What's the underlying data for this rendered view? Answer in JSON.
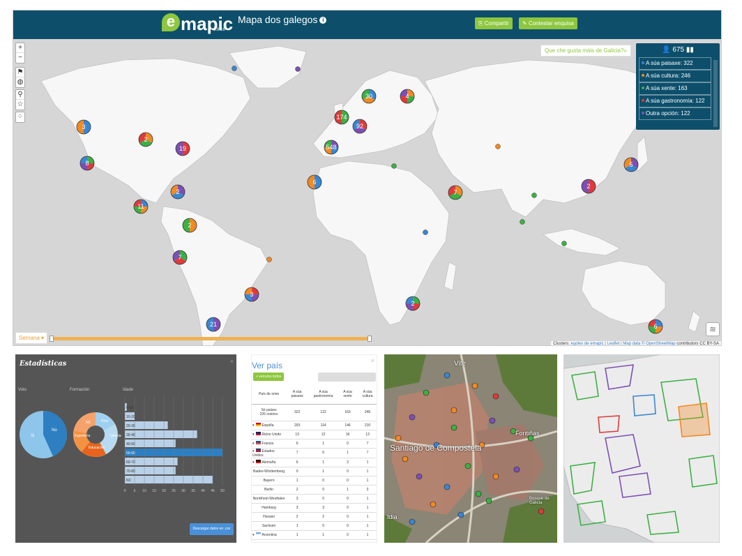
{
  "app": {
    "logo_text": "mapic",
    "logo_e": "e",
    "logo_sub": "3.8.16",
    "title": "Mapa dos galegos",
    "info_icon": "i",
    "share_label": "Compartir",
    "survey_label": "Contestar enquisa"
  },
  "map": {
    "question_link": "Que che gusta máis de Galicia?»",
    "zoom_in": "+",
    "zoom_out": "−",
    "semana_label": "Semana",
    "attribution_prefix": "Clusters:",
    "attribution_links": "egoles de emapic | Leaflet | Map data © OpenStreetMap",
    "attribution_suffix": "contributors CC BY-SA",
    "legend": {
      "count": "675",
      "items": [
        {
          "label": "A súa paisaxe: 322",
          "color": "#3a86d1"
        },
        {
          "label": "A súa cultura: 246",
          "color": "#f08a24"
        },
        {
          "label": "A súa xente: 163",
          "color": "#3cb043"
        },
        {
          "label": "A súa gastronomía: 122",
          "color": "#e03b3b"
        },
        {
          "label": "Outra opción: 122",
          "color": "#7d4fb5"
        }
      ]
    },
    "clusters": [
      {
        "label": "3"
      },
      {
        "label": "2"
      },
      {
        "label": "8"
      },
      {
        "label": "19"
      },
      {
        "label": "2"
      },
      {
        "label": "11"
      },
      {
        "label": "2"
      },
      {
        "label": "7"
      },
      {
        "label": "3"
      },
      {
        "label": "21"
      },
      {
        "label": "30"
      },
      {
        "label": "4"
      },
      {
        "label": "174"
      },
      {
        "label": "92"
      },
      {
        "label": "548"
      },
      {
        "label": "6"
      },
      {
        "label": "7"
      },
      {
        "label": "2"
      },
      {
        "label": "2"
      },
      {
        "label": "5"
      },
      {
        "label": "6"
      }
    ]
  },
  "stats": {
    "title": "Estadísticas",
    "close": "×",
    "vote_label": "Voto",
    "education_label": "Formación",
    "age_label": "Idade",
    "pie_no": "No",
    "pie_si": "Si",
    "donut_labels": [
      "Pote",
      "NC",
      "Ciencia",
      "Educación",
      "Ingeniería"
    ],
    "age_rows": [
      {
        "label": "0-10",
        "value": 1
      },
      {
        "label": "10-20",
        "value": 5
      },
      {
        "label": "20-30",
        "value": 22
      },
      {
        "label": "30-40",
        "value": 37
      },
      {
        "label": "40-50",
        "value": 26
      },
      {
        "label": "50-60",
        "value": 50
      },
      {
        "label": "60-70",
        "value": 27
      },
      {
        "label": "70-80",
        "value": 26
      },
      {
        "label": "NC",
        "value": 45
      }
    ],
    "age_ticks": [
      "0",
      "5",
      "10",
      "15",
      "20",
      "25",
      "30",
      "35",
      "40",
      "45",
      "50"
    ],
    "download_label": "Descargar datos en .csv"
  },
  "verpais": {
    "title": "Ver país",
    "close": "×",
    "tabs_label": "+ veículos    todos",
    "headers": [
      "País de orixe",
      "A súa paisaxe",
      "A súa gastronomía",
      "A súa xente",
      "A súa cultura"
    ],
    "total_label": "Só países",
    "total_sub": "226 rexións",
    "total_values": [
      "322",
      "122",
      "163",
      "246"
    ],
    "rows": [
      {
        "name": "España",
        "values": [
          "293",
          "114",
          "146",
          "210"
        ],
        "flag": "es"
      },
      {
        "name": "Reino Unido",
        "values": [
          "13",
          "12",
          "16",
          "13"
        ],
        "flag": "uk"
      },
      {
        "name": "Francia",
        "values": [
          "6",
          "1",
          "0",
          "7"
        ],
        "flag": "fr"
      },
      {
        "name": "Estados Unidos",
        "values": [
          "7",
          "6",
          "1",
          "7"
        ],
        "flag": "us"
      },
      {
        "name": "Alemaña",
        "values": [
          "6",
          "1",
          "3",
          "1"
        ],
        "flag": "de"
      },
      {
        "name": "Baden-Württemberg",
        "values": [
          "0",
          "1",
          "0",
          "1"
        ],
        "flag": ""
      },
      {
        "name": "Bayern",
        "values": [
          "1",
          "0",
          "0",
          "1"
        ],
        "flag": ""
      },
      {
        "name": "Berlin",
        "values": [
          "2",
          "0",
          "1",
          "3"
        ],
        "flag": ""
      },
      {
        "name": "Nordrhein-Westfalen",
        "values": [
          "3",
          "0",
          "0",
          "1"
        ],
        "flag": ""
      },
      {
        "name": "Hamburg",
        "values": [
          "3",
          "3",
          "0",
          "1"
        ],
        "flag": ""
      },
      {
        "name": "Hessen",
        "values": [
          "2",
          "2",
          "0",
          "1"
        ],
        "flag": ""
      },
      {
        "name": "Sachsen",
        "values": [
          "1",
          "0",
          "0",
          "1"
        ],
        "flag": ""
      },
      {
        "name": "Arxentina",
        "values": [
          "1",
          "1",
          "0",
          "1"
        ],
        "flag": "ar"
      }
    ]
  },
  "aerial": {
    "label_vite": "Vite",
    "label_city": "Santiago de Compostela",
    "label_fontinas": "Fontiñas",
    "label_bosque": "Bosque de Galicia",
    "label_idia": "Idia"
  }
}
